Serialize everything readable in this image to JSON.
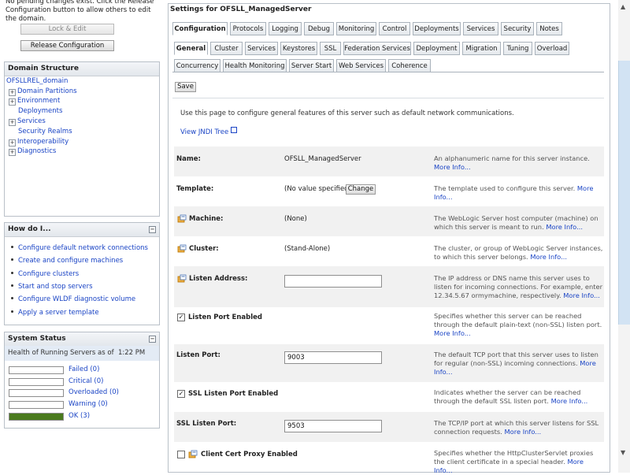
{
  "change_center": {
    "message": "No pending changes exist. Click the Release Configuration button to allow others to edit the domain.",
    "lock_edit": "Lock & Edit",
    "release_configuration": "Release Configuration"
  },
  "domain_structure": {
    "title": "Domain Structure",
    "root": "OFSLLREL_domain",
    "items": [
      {
        "label": "Domain Partitions",
        "expandable": true
      },
      {
        "label": "Environment",
        "expandable": true
      },
      {
        "label": "Deployments",
        "expandable": false
      },
      {
        "label": "Services",
        "expandable": true
      },
      {
        "label": "Security Realms",
        "expandable": false
      },
      {
        "label": "Interoperability",
        "expandable": true
      },
      {
        "label": "Diagnostics",
        "expandable": true
      }
    ]
  },
  "how_do_i": {
    "title": "How do I...",
    "links": [
      "Configure default network connections",
      "Create and configure machines",
      "Configure clusters",
      "Start and stop servers",
      "Configure WLDF diagnostic volume",
      "Apply a server template"
    ]
  },
  "system_status": {
    "title": "System Status",
    "health_label": "Health of Running Servers as of",
    "time": "1:22 PM",
    "states": [
      {
        "label": "Failed (0)",
        "fill": 0,
        "color": "#c00000"
      },
      {
        "label": "Critical (0)",
        "fill": 0,
        "color": "#ff0000"
      },
      {
        "label": "Overloaded (0)",
        "fill": 0,
        "color": "#ff9900"
      },
      {
        "label": "Warning (0)",
        "fill": 0,
        "color": "#ffcc00"
      },
      {
        "label": "OK (3)",
        "fill": 1,
        "color": "#4a7a1e"
      }
    ]
  },
  "settings": {
    "title": "Settings for OFSLL_ManagedServer",
    "main_tabs": [
      "Configuration",
      "Protocols",
      "Logging",
      "Debug",
      "Monitoring",
      "Control",
      "Deployments",
      "Services",
      "Security",
      "Notes"
    ],
    "sub_tabs_row1": [
      "General",
      "Cluster",
      "Services",
      "Keystores",
      "SSL",
      "Federation Services",
      "Deployment",
      "Migration",
      "Tuning",
      "Overload"
    ],
    "sub_tabs_row2": [
      "Concurrency",
      "Health Monitoring",
      "Server Start",
      "Web Services",
      "Coherence"
    ],
    "save": "Save",
    "intro": "Use this page to configure general features of this server such as default network communications.",
    "jndi_link": "View JNDI Tree",
    "change_button": "Change",
    "fields": [
      {
        "label": "Name:",
        "value": "OFSLL_ManagedServer",
        "help": "An alphanumeric name for this server instance.",
        "more": "More Info..."
      },
      {
        "label": "Template:",
        "value": "(No value specified)",
        "help": "The template used to configure this server.",
        "more": "More Info..."
      },
      {
        "label": "Machine:",
        "value": "(None)",
        "help": "The WebLogic Server host computer (machine) on which this server is meant to run.",
        "more": "More Info..."
      },
      {
        "label": "Cluster:",
        "value": "(Stand-Alone)",
        "help": "The cluster, or group of WebLogic Server instances, to which this server belongs.",
        "more": "More Info..."
      },
      {
        "label": "Listen Address:",
        "value": "",
        "help": "The IP address or DNS name this server uses to listen for incoming connections. For example, enter 12.34.5.67 ormymachine, respectively.",
        "more": "More Info..."
      },
      {
        "label": "Listen Port Enabled",
        "checked": true,
        "help": "Specifies whether this server can be reached through the default plain-text (non-SSL) listen port.",
        "more": "More Info..."
      },
      {
        "label": "Listen Port:",
        "value": "9003",
        "help": "The default TCP port that this server uses to listen for regular (non-SSL) incoming connections.",
        "more": "More Info..."
      },
      {
        "label": "SSL Listen Port Enabled",
        "checked": true,
        "help": "Indicates whether the server can be reached through the default SSL listen port.",
        "more": "More Info..."
      },
      {
        "label": "SSL Listen Port:",
        "value": "9503",
        "help": "The TCP/IP port at which this server listens for SSL connection requests.",
        "more": "More Info..."
      },
      {
        "label": "Client Cert Proxy Enabled",
        "checked": false,
        "help": "Specifies whether the HttpClusterServlet proxies the client certificate in a special header.",
        "more": "More Info..."
      }
    ]
  },
  "colors": {
    "link": "#1a44c5",
    "panel_border": "#b9c0c8",
    "row_bg": "#f1f1f1",
    "ok_green": "#4a7a1e",
    "scroll_thumb": "#d2e3f3"
  }
}
